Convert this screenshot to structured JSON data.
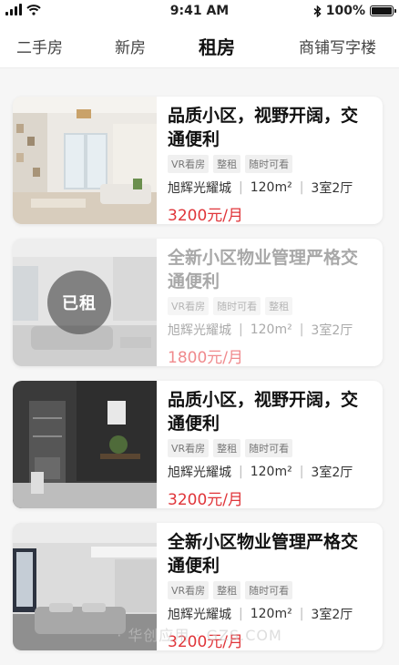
{
  "status_bar": {
    "time": "9:41 AM",
    "battery": "100%",
    "battery_level": 1.0
  },
  "tabs": [
    {
      "label": "二手房",
      "active": false
    },
    {
      "label": "新房",
      "active": false
    },
    {
      "label": "租房",
      "active": true
    },
    {
      "label": "商铺写字楼",
      "active": false
    }
  ],
  "listings": [
    {
      "title": "品质小区，视野开阔，交通便利",
      "tags": [
        "VR看房",
        "整租",
        "随时可看"
      ],
      "community": "旭辉光耀城",
      "area": "120m²",
      "layout": "3室2厅",
      "price": "3200元/月",
      "rented": false,
      "badge": ""
    },
    {
      "title": "全新小区物业管理严格交通便利",
      "tags": [
        "VR看房",
        "随时可看",
        "整租"
      ],
      "community": "旭辉光耀城",
      "area": "120m²",
      "layout": "3室2厅",
      "price": "1800元/月",
      "rented": true,
      "badge": "已租"
    },
    {
      "title": "品质小区，视野开阔，交通便利",
      "tags": [
        "VR看房",
        "整租",
        "随时可看"
      ],
      "community": "旭辉光耀城",
      "area": "120m²",
      "layout": "3室2厅",
      "price": "3200元/月",
      "rented": false,
      "badge": ""
    },
    {
      "title": "全新小区物业管理严格交通便利",
      "tags": [
        "VR看房",
        "整租",
        "随时可看"
      ],
      "community": "旭辉光耀城",
      "area": "120m²",
      "layout": "3室2厅",
      "price": "3200元/月",
      "rented": false,
      "badge": ""
    }
  ],
  "watermark": "· 华创应用 · GZS.COM",
  "colors": {
    "price": "#e0353a",
    "rented_price": "#f08a8d",
    "active_tab": "#111111"
  }
}
